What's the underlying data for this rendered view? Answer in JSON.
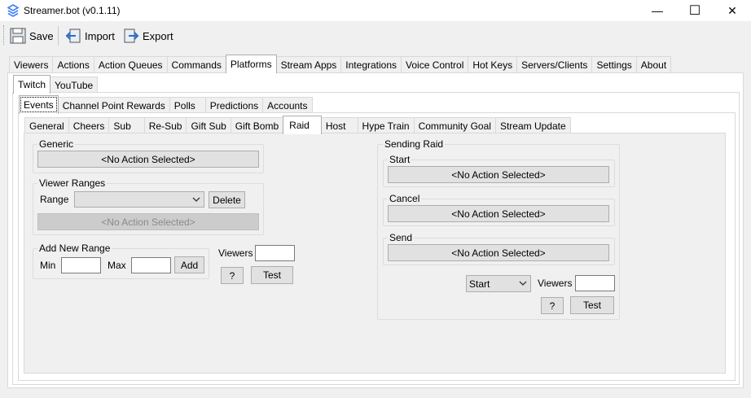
{
  "window": {
    "title": "Streamer.bot (v0.1.11)",
    "minimize": "—",
    "maximize": "☐",
    "close": "✕",
    "icon": "streamerbot-logo-icon",
    "accent": "#3b82f6"
  },
  "toolbar": {
    "save_label": "Save",
    "import_label": "Import",
    "export_label": "Export"
  },
  "main_tabs": [
    "Viewers",
    "Actions",
    "Action Queues",
    "Commands",
    "Platforms",
    "Stream Apps",
    "Integrations",
    "Voice Control",
    "Hot Keys",
    "Servers/Clients",
    "Settings",
    "About"
  ],
  "main_tab_selected": "Platforms",
  "platform_tabs": [
    "Twitch",
    "YouTube"
  ],
  "platform_tab_selected": "Twitch",
  "twitch_tabs": [
    "Events",
    "Channel Point Rewards",
    "Polls",
    "Predictions",
    "Accounts"
  ],
  "twitch_tab_selected": "Events",
  "event_tabs": [
    "General",
    "Cheers",
    "Sub",
    "Re-Sub",
    "Gift Sub",
    "Gift Bomb",
    "Raid",
    "Host",
    "Hype Train",
    "Community Goal",
    "Stream Update"
  ],
  "event_tab_selected": "Raid",
  "generic": {
    "label": "Generic",
    "action": "<No Action Selected>"
  },
  "viewer_ranges": {
    "label": "Viewer Ranges",
    "range_label": "Range",
    "range_value": "",
    "delete_label": "Delete",
    "action": "<No Action Selected>"
  },
  "add_new_range": {
    "label": "Add New Range",
    "min_label": "Min",
    "min_value": "",
    "max_label": "Max",
    "max_value": "",
    "add_label": "Add"
  },
  "test_left": {
    "viewers_label": "Viewers",
    "viewers_value": "",
    "help_label": "?",
    "test_label": "Test"
  },
  "sending_raid": {
    "label": "Sending Raid",
    "start": {
      "label": "Start",
      "action": "<No Action Selected>"
    },
    "cancel": {
      "label": "Cancel",
      "action": "<No Action Selected>"
    },
    "send": {
      "label": "Send",
      "action": "<No Action Selected>"
    },
    "type_value": "Start",
    "viewers_label": "Viewers",
    "viewers_value": "",
    "help_label": "?",
    "test_label": "Test"
  }
}
